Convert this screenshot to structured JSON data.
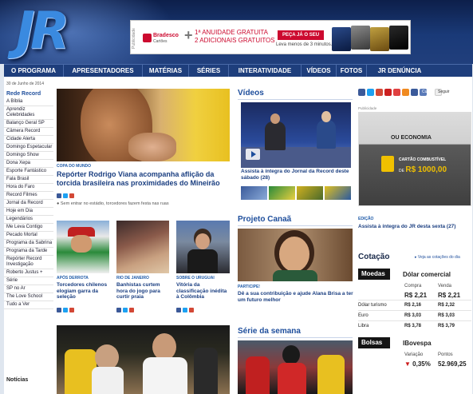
{
  "header": {
    "logo_text": "JR",
    "ad": {
      "side_label": "Publicidade",
      "brand": "Bradesco",
      "brand_sub": "Cartões",
      "plus": "+",
      "line1": "1ª ANUIDADE GRATUITA",
      "line2": "2 ADICIONAIS GRATUITOS",
      "cta": "PEÇA JÁ O SEU",
      "cta_sub": "Leva menos de 3 minutos."
    }
  },
  "nav": {
    "items": [
      "O PROGRAMA",
      "APRESENTADORES",
      "MATÉRIAS",
      "SÉRIES",
      "INTERATIVIDADE",
      "VÍDEOS",
      "FOTOS",
      "JR DENÚNCIA"
    ]
  },
  "date": "30 de Junho de 2014",
  "sidebar": {
    "heading": "Rede Record",
    "items": [
      "A Bíblia",
      "Aprendiz Celebridades",
      "Balanço Geral SP",
      "Câmera Record",
      "Cidade Alerta",
      "Domingo Espetacular",
      "Domingo Show",
      "Dona Xepa",
      "Esporte Fantástico",
      "Fala Brasil",
      "Hora do Faro",
      "Record Filmes",
      "Jornal da Record",
      "Hoje em Dia",
      "Legendários",
      "Me Leva Contigo",
      "Pecado Mortal",
      "Programa da Sabrina",
      "Programa da Tarde",
      "Repórter Record Investigação",
      "Roberto Justus +",
      "Série",
      "SP no Ar",
      "The Love School",
      "Tudo a Ver"
    ],
    "news_heading": "Notícias"
  },
  "main": {
    "hero_tag": "COPA DO MUNDO",
    "hero_headline": "Repórter Rodrigo Viana acompanha aflição da torcida brasileira nas proximidades do Mineirão",
    "hero_bullet": "Sem entrar no estádio, torcedores fazem festa nas ruas",
    "cards": [
      {
        "tag": "APÓS DERROTA",
        "headline": "Torcedores chilenos elogiam garra da seleção"
      },
      {
        "tag": "RIO DE JANEIRO",
        "headline": "Banhistas curtem hora do jogo para curtir praia"
      },
      {
        "tag": "SOBRE O URUGUAI",
        "headline": "Vitória da classificação inédita à Colômbia"
      }
    ]
  },
  "videos": {
    "title": "Vídeos",
    "caption": "Assista à íntegra do Jornal da Record deste sábado (28)"
  },
  "projeto": {
    "title": "Projeto Canaã",
    "tag": "PARTICIPE!",
    "caption": "Dê a sua contribuição e ajude Alana Brisa a ter um futuro melhor"
  },
  "serie": {
    "title": "Série da semana"
  },
  "right": {
    "social_like": "Curtir",
    "social_follow": "Seguir",
    "pub_label": "Publicidade",
    "ad_title": "OU ECONOMIA",
    "ad_line": "CARTÃO COMBUSTÍVEL",
    "ad_prefix": "DE",
    "ad_price": "R$ 1000,00",
    "edition_tag": "EDIÇÃO",
    "edition_caption": "Assista à íntegra do JR desta sexta (27)",
    "quotes_title": "Cotação",
    "quotes_link": "Veja as cotações do dia",
    "moedas_label": "Moedas",
    "moedas_title": "Dólar comercial",
    "col_buy": "Compra",
    "col_sell": "Venda",
    "main_buy": "R$ 2,21",
    "main_sell": "R$ 2,21",
    "rows": [
      {
        "name": "Dólar turismo",
        "buy": "R$ 2,16",
        "sell": "R$ 2,32"
      },
      {
        "name": "Euro",
        "buy": "R$ 3,03",
        "sell": "R$ 3,03"
      },
      {
        "name": "Libra",
        "buy": "R$ 3,78",
        "sell": "R$ 3,79"
      }
    ],
    "bolsas_label": "Bolsas",
    "bolsas_title": "IBovespa",
    "col_var": "Variação",
    "col_points": "Pontos",
    "variation": "0,35%",
    "points": "52.969,25"
  },
  "colors": {
    "nav_bg": "#1e3e7c",
    "link_blue": "#1a3e80",
    "down_red": "#cc1a1a"
  }
}
